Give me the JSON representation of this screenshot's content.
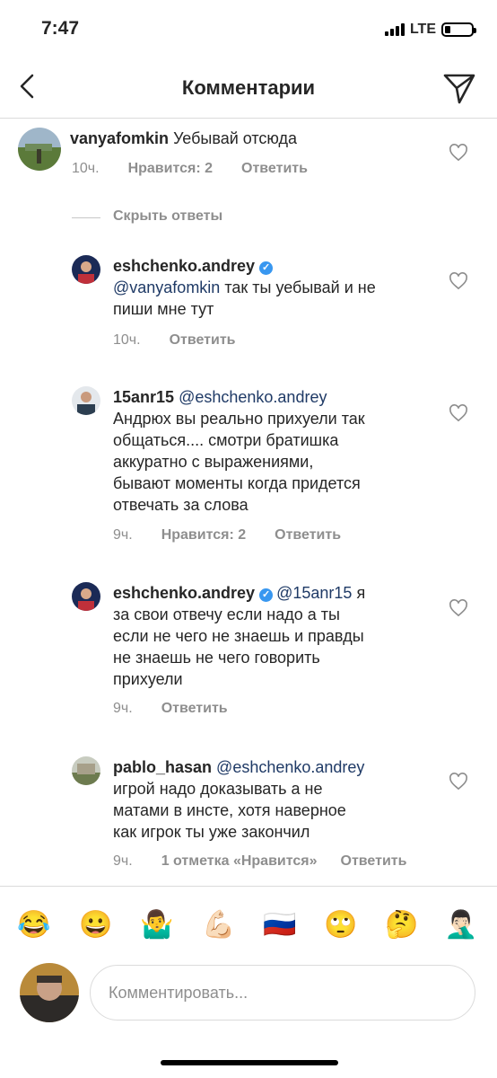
{
  "status": {
    "time": "7:47",
    "network": "LTE"
  },
  "nav": {
    "title": "Комментарии"
  },
  "comments": [
    {
      "user": "vanyafomkin",
      "mention": "",
      "text": "Уебывай отсюда",
      "time": "10ч.",
      "likes": "Нравится: 2",
      "reply": "Ответить",
      "verified": false
    },
    {
      "user": "eshchenko.andrey",
      "mention": "@vanyafomkin",
      "text": "так ты уебывай и не",
      "text2": "пиши мне тут",
      "time": "10ч.",
      "likes": "",
      "reply": "Ответить",
      "verified": true
    },
    {
      "user": "15anr15",
      "mention": "@eshchenko.andrey",
      "line1": "Андрюх вы реально прихуели так",
      "line2": "общаться.... смотри братишка",
      "line3": "аккуратно с выражениями,",
      "line4": "бывают моменты когда придется",
      "line5": "отвечать за слова",
      "time": "9ч.",
      "likes": "Нравится: 2",
      "reply": "Ответить",
      "verified": false
    },
    {
      "user": "eshchenko.andrey",
      "mention": "@15anr15",
      "tail": "я",
      "line2": "за свои отвечу если надо а ты",
      "line3": "если не чего не знаешь и правды",
      "line4": "не знаешь не чего говорить",
      "line5": "прихуели",
      "time": "9ч.",
      "likes": "",
      "reply": "Ответить",
      "verified": true
    },
    {
      "user": "pablo_hasan",
      "mention": "@eshchenko.andrey",
      "line2": "игрой надо доказывать а не",
      "line3": "матами в инсте, хотя наверное",
      "line4": "как игрок ты уже закончил",
      "time": "9ч.",
      "likes": "1 отметка «Нравится»",
      "reply": "Ответить",
      "verified": false
    }
  ],
  "hide_replies": "Скрыть ответы",
  "emojis": [
    "😂",
    "😀",
    "🤷‍♂️",
    "💪🏻",
    "🇷🇺",
    "🙄",
    "🤔",
    "🤦🏻‍♂️"
  ],
  "input": {
    "placeholder": "Комментировать..."
  },
  "colors": {
    "mention": "#1f3a66",
    "muted": "#8e8e8e",
    "verified": "#3897f0",
    "divider": "#dbdbdb"
  }
}
